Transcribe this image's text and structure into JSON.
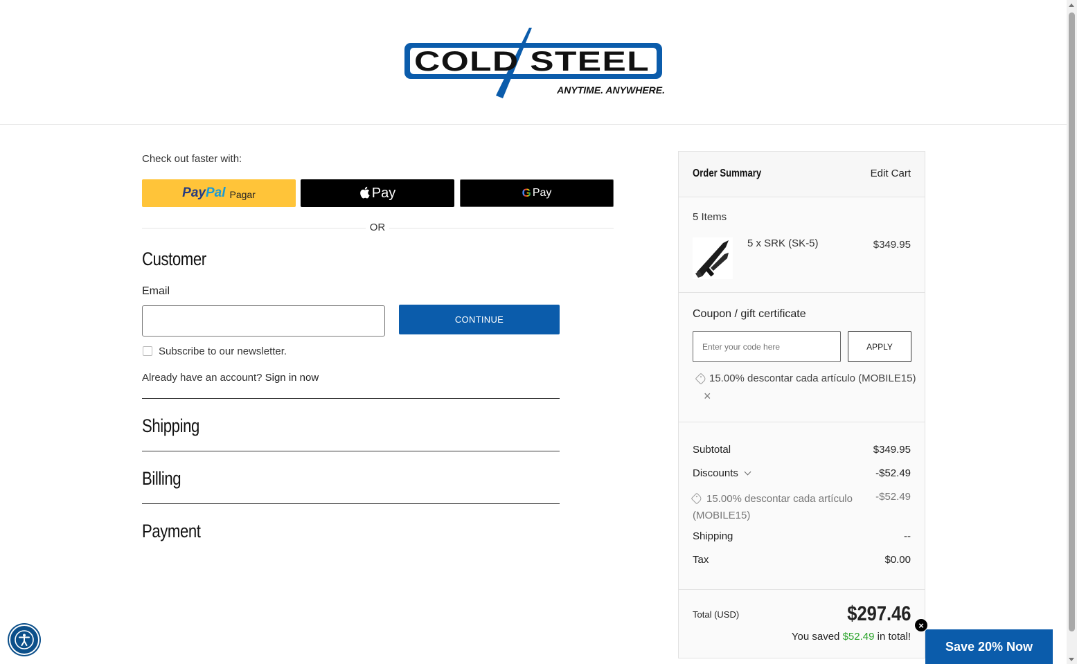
{
  "header": {
    "logo_brand": "COLD STEEL",
    "logo_tagline": "ANYTIME. ANYWHERE."
  },
  "express": {
    "label": "Check out faster with:",
    "paypal_pay": "Pay",
    "paypal_pal": "Pal",
    "paypal_text": "Pagar",
    "applepay_text": "Pay",
    "gpay_g": "G",
    "gpay_text": "Pay",
    "or": "OR"
  },
  "customer": {
    "heading": "Customer",
    "email_label": "Email",
    "email_value": "",
    "continue_label": "CONTINUE",
    "newsletter_label": "Subscribe to our newsletter.",
    "account_prompt": "Already have an account?",
    "signin_label": "Sign in now"
  },
  "steps": {
    "shipping": "Shipping",
    "billing": "Billing",
    "payment": "Payment"
  },
  "summary": {
    "title": "Order Summary",
    "edit_cart": "Edit Cart",
    "items_count": "5 Items",
    "product_name": "5 x SRK (SK-5)",
    "product_price": "$349.95",
    "coupon_label": "Coupon / gift certificate",
    "coupon_placeholder": "Enter your code here",
    "apply_label": "APPLY",
    "applied_coupon": "15.00% descontar cada artículo (MOBILE15)",
    "remove_icon": "×",
    "subtotal_label": "Subtotal",
    "subtotal_value": "$349.95",
    "discounts_label": "Discounts",
    "discounts_value": "-$52.49",
    "discount_detail": "15.00% descontar cada artículo (MOBILE15)",
    "discount_detail_value": "-$52.49",
    "shipping_label": "Shipping",
    "shipping_value": "--",
    "tax_label": "Tax",
    "tax_value": "$0.00",
    "total_label": "Total (USD)",
    "total_value": "$297.46",
    "saved_prefix": "You saved",
    "saved_amount": "$52.49",
    "saved_suffix": "in total!"
  },
  "promo": {
    "label": "Save 20% Now",
    "close": "×"
  },
  "colors": {
    "brand_blue": "#0b5cab",
    "paypal_yellow": "#ffc439",
    "saved_green": "#2aa32a"
  },
  "icons": [
    "logo",
    "paypal-logo",
    "apple-icon",
    "google-g-icon",
    "tag-icon",
    "close-icon",
    "chevron-down-icon",
    "accessibility-icon"
  ]
}
